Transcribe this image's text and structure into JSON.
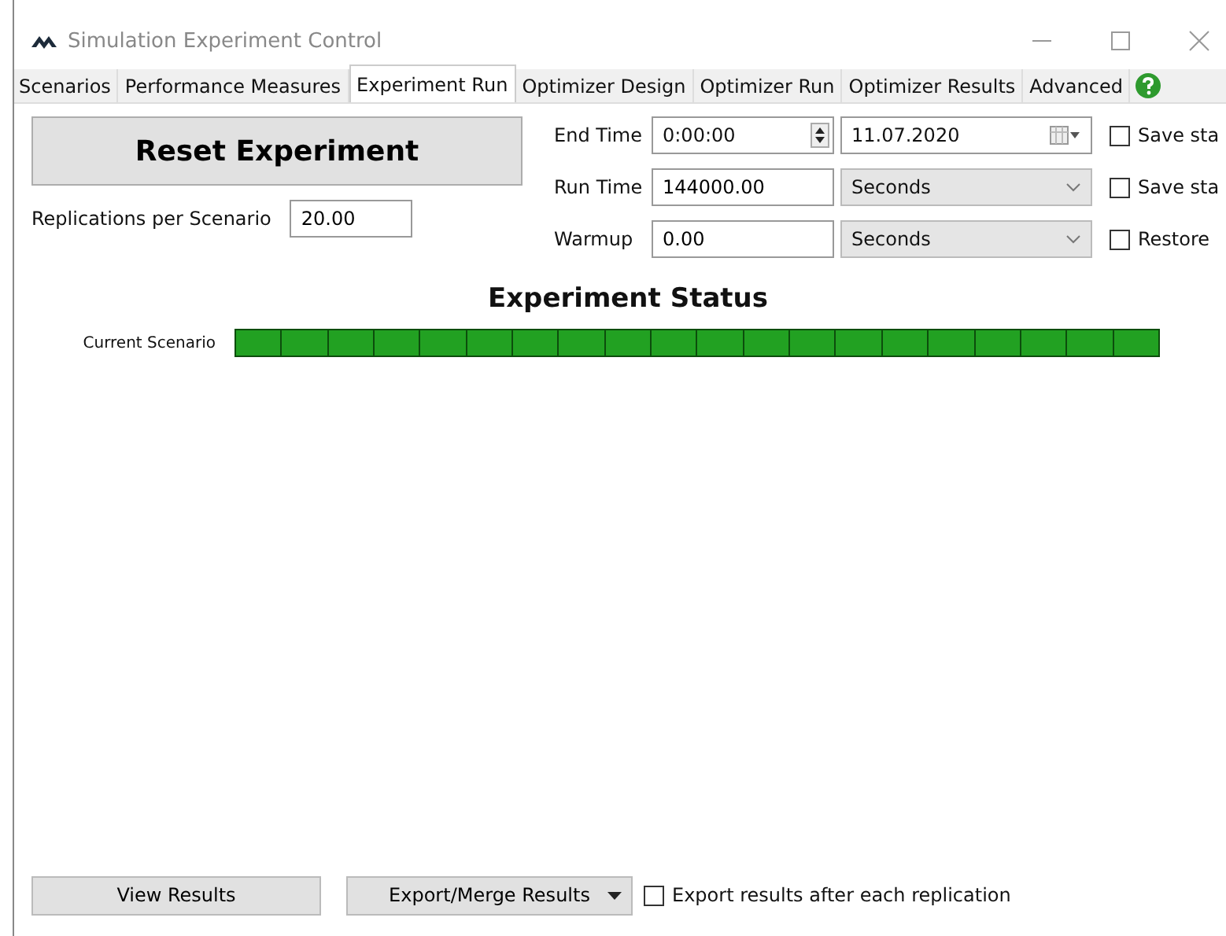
{
  "window": {
    "title": "Simulation Experiment Control"
  },
  "tabs": [
    {
      "label": "Scenarios",
      "selected": false
    },
    {
      "label": "Performance Measures",
      "selected": false
    },
    {
      "label": "Experiment Run",
      "selected": true
    },
    {
      "label": "Optimizer Design",
      "selected": false
    },
    {
      "label": "Optimizer Run",
      "selected": false
    },
    {
      "label": "Optimizer Results",
      "selected": false
    },
    {
      "label": "Advanced",
      "selected": false
    }
  ],
  "reset_button": "Reset Experiment",
  "replications": {
    "label": "Replications per Scenario",
    "value": "20.00"
  },
  "time_rows": [
    {
      "label": "End Time",
      "kind": "time",
      "value": "0:00:00",
      "unit": "11.07.2020",
      "option": "Save sta",
      "checked": false
    },
    {
      "label": "Run Time",
      "kind": "number",
      "value": "144000.00",
      "unit": "Seconds",
      "option": "Save sta",
      "checked": false
    },
    {
      "label": "Warmup",
      "kind": "number",
      "value": "0.00",
      "unit": "Seconds",
      "option": "Restore",
      "checked": false
    }
  ],
  "status": {
    "title": "Experiment Status",
    "label": "Current Scenario",
    "level": 1
  },
  "bottom": {
    "view_button": "View Results",
    "export_button": "Export/Merge Results",
    "export_option": {
      "label": "Export results after each replication",
      "checked": false
    }
  }
}
